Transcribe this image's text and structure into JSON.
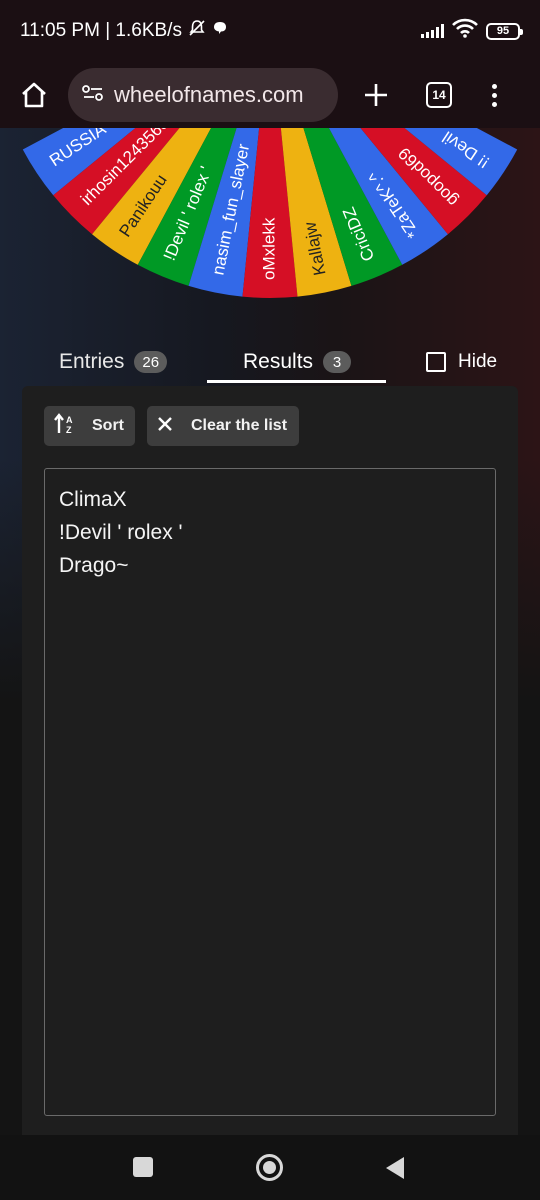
{
  "status_bar": {
    "time_and_speed": "11:05 PM | 1.6KB/s",
    "battery_level": "95"
  },
  "browser": {
    "url": "wheelofnames.com",
    "tab_count": "14"
  },
  "wheel": {
    "segments": [
      {
        "label": "RUSSIA",
        "color": "#3369e8"
      },
      {
        "label": "irhosin1243563",
        "color": "#d50f25"
      },
      {
        "label": "Panikouu",
        "color": "#eeb211"
      },
      {
        "label": "!Devil ' rolex '",
        "color": "#009925"
      },
      {
        "label": "nasim_fun_slayer",
        "color": "#3369e8"
      },
      {
        "label": "oMxlekk",
        "color": "#d50f25"
      },
      {
        "label": "Kallajw",
        "color": "#eeb211"
      },
      {
        "label": "CriciDZ",
        "color": "#009925"
      },
      {
        "label": "*ZaTeK^.^",
        "color": "#3369e8"
      },
      {
        "label": "goopod69",
        "color": "#d50f25"
      },
      {
        "label": "!! Devil",
        "color": "#3369e8"
      }
    ]
  },
  "tabs": {
    "entries_label": "Entries",
    "entries_count": "26",
    "results_label": "Results",
    "results_count": "3",
    "hide_label": "Hide"
  },
  "toolbar": {
    "sort_label": "Sort",
    "clear_label": "Clear the list"
  },
  "results": [
    "ClimaX",
    "!Devil ' rolex '",
    "Drago~"
  ]
}
